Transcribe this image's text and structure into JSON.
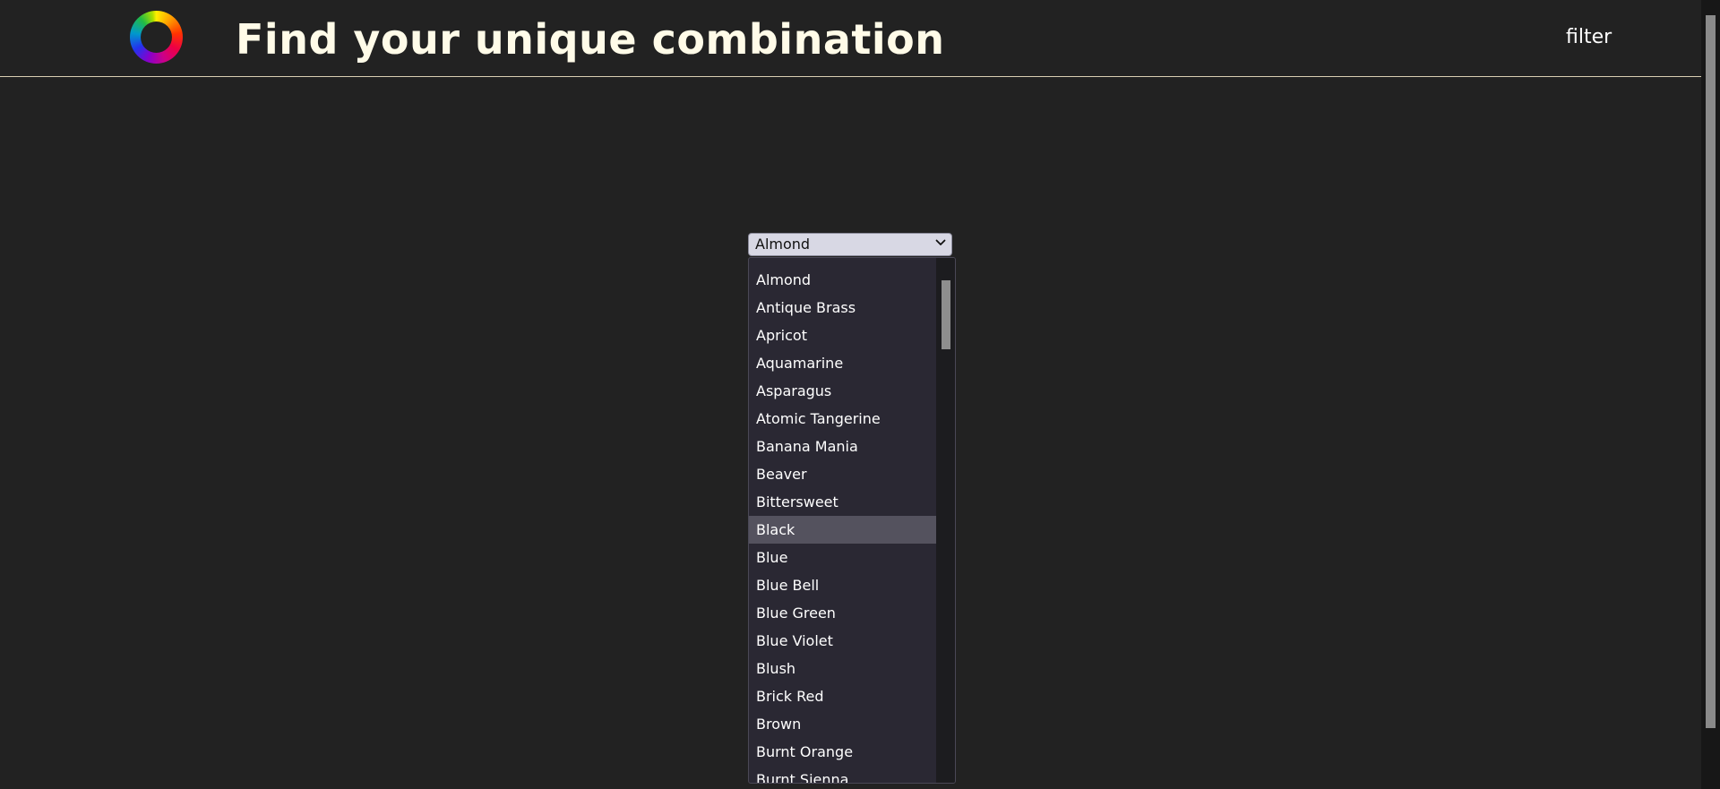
{
  "header": {
    "title": "Find your unique combination",
    "filter_label": "filter",
    "logo_icon": "color-wheel-icon"
  },
  "color_select": {
    "selected_value": "Almond",
    "chevron_icon": "chevron-down-icon",
    "highlighted_option": "Black",
    "options": [
      "Almond",
      "Antique Brass",
      "Apricot",
      "Aquamarine",
      "Asparagus",
      "Atomic Tangerine",
      "Banana Mania",
      "Beaver",
      "Bittersweet",
      "Black",
      "Blue",
      "Blue Bell",
      "Blue Green",
      "Blue Violet",
      "Blush",
      "Brick Red",
      "Brown",
      "Burnt Orange",
      "Burnt Sienna"
    ]
  },
  "colors": {
    "background": "#222222",
    "header_rule": "#d9cfb3",
    "dropdown_bg": "#2a2833",
    "highlight": "#54525e"
  }
}
